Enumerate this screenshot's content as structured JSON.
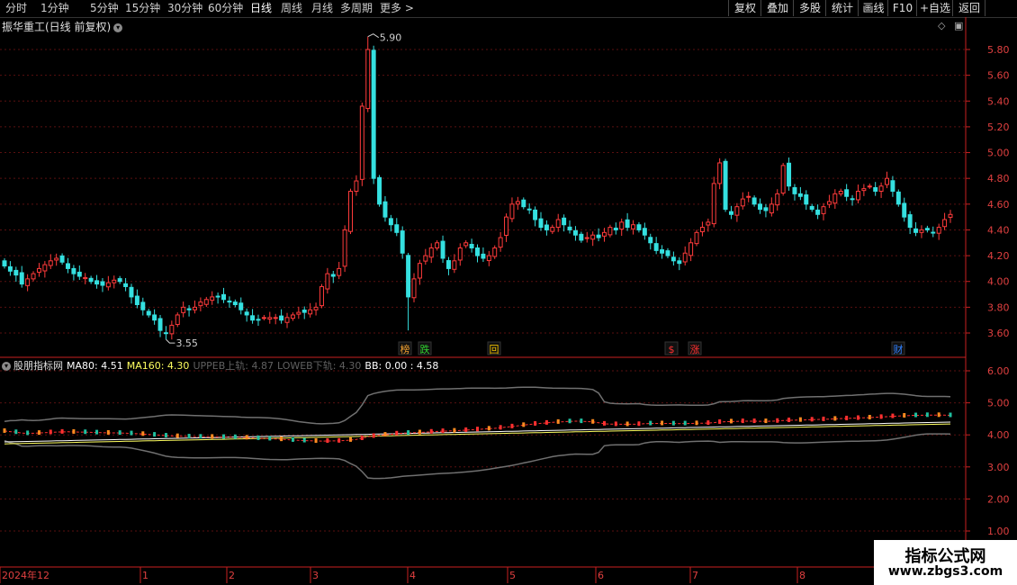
{
  "toolbar": {
    "periods": [
      "分时",
      "1分钟",
      "5分钟",
      "15分钟",
      "30分钟",
      "60分钟",
      "日线",
      "周线",
      "月线",
      "多周期",
      "更多 >"
    ],
    "active_period": "日线",
    "buttons": [
      "复权",
      "叠加",
      "多股",
      "统计",
      "画线",
      "F10",
      "+自选",
      "返回"
    ]
  },
  "main_chart": {
    "title": "振华重工(日线 前复权)",
    "high_label": "5.90",
    "low_label": "3.55",
    "y_ticks": [
      "5.80",
      "5.60",
      "5.40",
      "5.20",
      "5.00",
      "4.80",
      "4.60",
      "4.40",
      "4.20",
      "4.00",
      "3.80",
      "3.60"
    ],
    "markers": [
      {
        "text": "榜",
        "color": "#f0a030"
      },
      {
        "text": "跌",
        "color": "#30d030"
      },
      {
        "text": "回",
        "color": "#f0c000"
      },
      {
        "text": "$",
        "color": "#ff3030"
      },
      {
        "text": "涨",
        "color": "#ff3030"
      },
      {
        "text": "财",
        "color": "#3080ff"
      }
    ]
  },
  "indicator": {
    "name": "股朋指标网",
    "ma80": "MA80: 4.51",
    "ma160": "MA160: 4.30",
    "upper": "UPPEB上轨: 4.87",
    "lower": "LOWEB下轨: 4.30",
    "bb": "BB: 0.00 : 4.58",
    "y_ticks": [
      "6.00",
      "5.00",
      "4.00",
      "3.00",
      "2.00",
      "1.00"
    ]
  },
  "xaxis": {
    "labels": [
      "2024年12",
      "1",
      "2",
      "3",
      "4",
      "5",
      "6",
      "7",
      "8"
    ]
  },
  "colors": {
    "up": "#ff3b3b",
    "down": "#35e0e0",
    "axis": "#c82020",
    "ma80": "#ffffff",
    "ma160": "#ffff60"
  },
  "chart_data": {
    "type": "candlestick",
    "title": "振华重工(日线 前复权)",
    "ylim": [
      3.52,
      5.96
    ],
    "high": 5.9,
    "low": 3.55,
    "close_series": [
      4.12,
      4.08,
      4.05,
      3.98,
      4.02,
      4.06,
      4.1,
      4.13,
      4.16,
      4.18,
      4.15,
      4.1,
      4.06,
      4.04,
      4.03,
      4.0,
      3.98,
      3.97,
      3.99,
      4.01,
      4.0,
      3.96,
      3.88,
      3.82,
      3.78,
      3.74,
      3.7,
      3.62,
      3.6,
      3.66,
      3.74,
      3.8,
      3.78,
      3.8,
      3.84,
      3.86,
      3.88,
      3.88,
      3.86,
      3.84,
      3.82,
      3.78,
      3.74,
      3.7,
      3.7,
      3.72,
      3.72,
      3.72,
      3.7,
      3.72,
      3.74,
      3.76,
      3.76,
      3.78,
      3.8,
      3.96,
      4.06,
      4.04,
      4.1,
      4.4,
      4.7,
      4.78,
      5.36,
      5.8,
      4.8,
      4.6,
      4.5,
      4.44,
      4.38,
      4.22,
      3.88,
      4.02,
      4.14,
      4.2,
      4.26,
      4.3,
      4.18,
      4.1,
      4.16,
      4.26,
      4.3,
      4.26,
      4.2,
      4.18,
      4.2,
      4.26,
      4.34,
      4.5,
      4.6,
      4.62,
      4.58,
      4.56,
      4.48,
      4.42,
      4.4,
      4.42,
      4.48,
      4.44,
      4.4,
      4.36,
      4.32,
      4.34,
      4.36,
      4.34,
      4.38,
      4.42,
      4.4,
      4.46,
      4.42,
      4.44,
      4.4,
      4.36,
      4.3,
      4.24,
      4.22,
      4.2,
      4.16,
      4.14,
      4.22,
      4.3,
      4.38,
      4.42,
      4.46,
      4.76,
      4.92,
      4.56,
      4.52,
      4.58,
      4.64,
      4.66,
      4.6,
      4.56,
      4.55,
      4.6,
      4.68,
      4.9,
      4.74,
      4.68,
      4.66,
      4.6,
      4.56,
      4.52,
      4.58,
      4.62,
      4.68,
      4.7,
      4.66,
      4.64,
      4.7,
      4.72,
      4.74,
      4.7,
      4.74,
      4.8,
      4.7,
      4.6,
      4.5,
      4.42,
      4.38,
      4.4,
      4.4,
      4.38,
      4.42,
      4.48,
      4.52
    ]
  }
}
